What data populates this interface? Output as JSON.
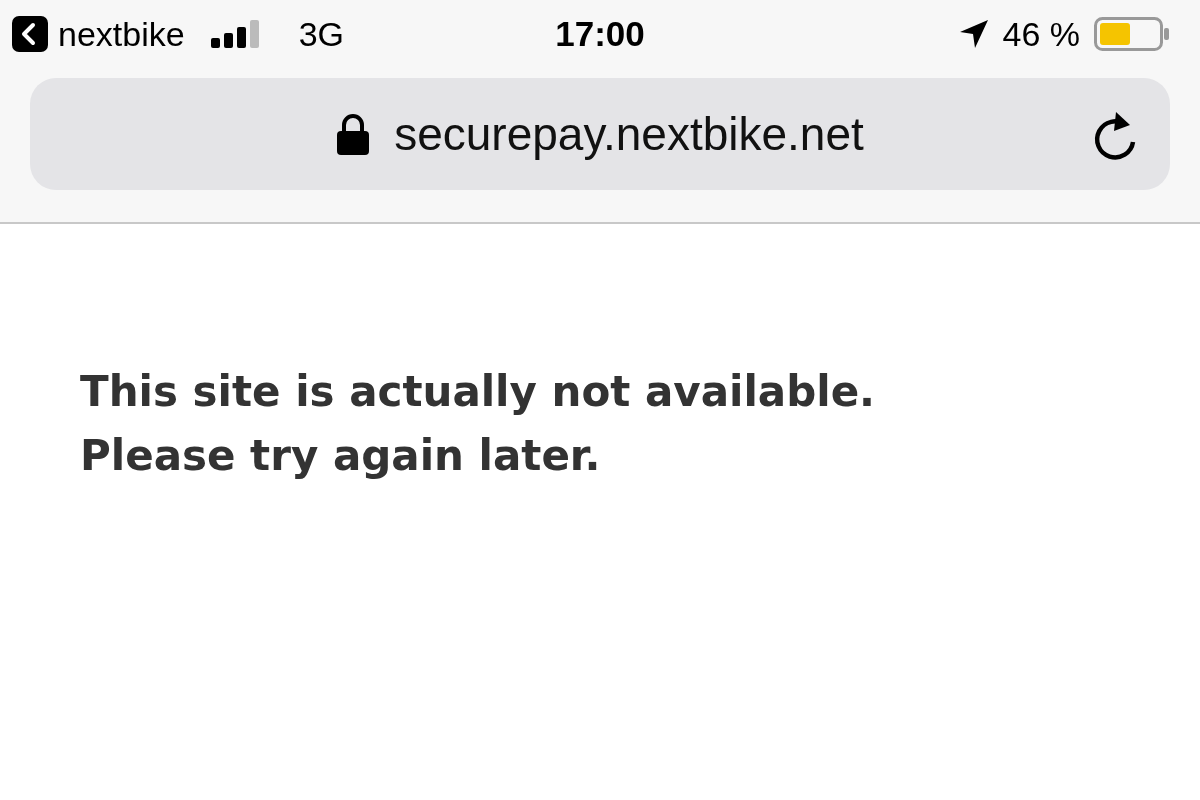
{
  "status_bar": {
    "back_app": "nextbike",
    "network": "3G",
    "time": "17:00",
    "battery": "46 %"
  },
  "address_bar": {
    "url": "securepay.nextbike.net"
  },
  "message": [
    "This site is actually not available.",
    "Please try again later."
  ]
}
